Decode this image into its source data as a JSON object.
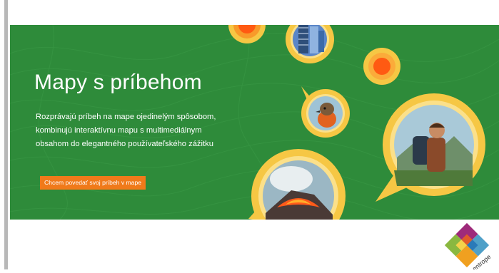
{
  "hero": {
    "title": "Mapy s príbehom",
    "description": "Rozprávajú príbeh na mape ojedinelým spôsobom, kombinujú interaktívnu mapu s multimediálnym obsahom do elegantného používateľského zážitku",
    "cta_label": "Chcem povedať svoj príbeh v mape"
  },
  "logo": {
    "text": "centrope"
  },
  "colors": {
    "hero_background": "#2e8b3a",
    "cta_background": "#f07a1a",
    "bubble_ring": "#f6c744",
    "bubble_ring_light": "#fbe08a",
    "accent_orange": "#ff6a1a"
  },
  "images": [
    {
      "name": "skyscraper-photo"
    },
    {
      "name": "robin-bird-photo"
    },
    {
      "name": "hiker-photo"
    },
    {
      "name": "volcano-photo"
    }
  ]
}
